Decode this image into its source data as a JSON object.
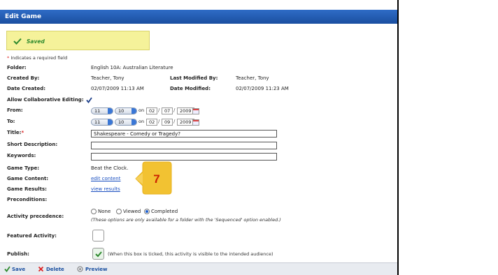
{
  "header": {
    "title": "Edit Game"
  },
  "status": {
    "saved_label": "Saved"
  },
  "required_note": {
    "star": "*",
    "text": " Indicates a required field"
  },
  "fields": {
    "folder": {
      "label": "Folder:",
      "value": "English 10A: Australian Literature"
    },
    "created_by": {
      "label": "Created By:",
      "value": "Teacher, Tony"
    },
    "last_modified_by": {
      "label": "Last Modified By:",
      "value": "Teacher, Tony"
    },
    "date_created": {
      "label": "Date Created:",
      "value": "02/07/2009 11:13 AM"
    },
    "date_modified": {
      "label": "Date Modified:",
      "value": "02/07/2009 11:23 AM"
    },
    "allow_collab": {
      "label": "Allow Collaborative Editing:",
      "checked": true
    },
    "from": {
      "label": "From:",
      "hour": "11",
      "minute": "10",
      "on": "on",
      "day": "02",
      "month": "07",
      "year": "2009"
    },
    "to": {
      "label": "To:",
      "hour": "11",
      "minute": "10",
      "on": "on",
      "day": "02",
      "month": "09",
      "year": "2009"
    },
    "title": {
      "label": "Title:",
      "required_star": "*",
      "value": "Shakespeare - Comedy or Tragedy?"
    },
    "short_description": {
      "label": "Short Description:",
      "value": ""
    },
    "keywords": {
      "label": "Keywords:",
      "value": ""
    },
    "game_type": {
      "label": "Game Type:",
      "value": "Beat the Clock."
    },
    "game_content": {
      "label": "Game Content:",
      "link": "edit content"
    },
    "game_results": {
      "label": "Game Results:",
      "link": "view results"
    },
    "preconditions": {
      "label": "Preconditions:"
    },
    "activity_precedence": {
      "label": "Activity precedence:",
      "options": [
        "None",
        "Viewed",
        "Completed"
      ],
      "selected": "Completed",
      "note": "(These options are only available for a folder with the 'Sequenced' option enabled.)"
    },
    "featured_activity": {
      "label": "Featured Activity:",
      "checked": false
    },
    "publish": {
      "label": "Publish:",
      "checked": true,
      "note": "(When this box is ticked, this activity is visible to the intended audience)"
    }
  },
  "callout": {
    "number": "7",
    "color": "#f2c232",
    "text_color": "#cc2200"
  },
  "footer": {
    "save": "Save",
    "delete": "Delete",
    "preview": "Preview"
  },
  "colors": {
    "header": "#2460b8",
    "link": "#1a4fc0",
    "saved_bg": "#f5f29a",
    "accent_green": "#2e8a2e"
  }
}
